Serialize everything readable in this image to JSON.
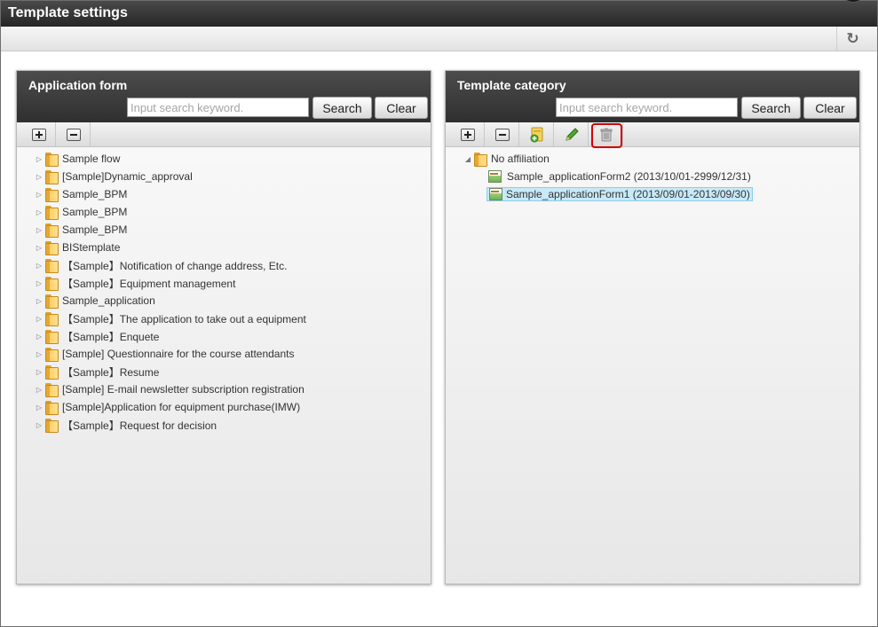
{
  "window": {
    "title": "Template settings"
  },
  "icons": {
    "refresh": "refresh-icon",
    "expand_all": "expand-all-icon",
    "collapse_all": "collapse-all-icon",
    "add_category": "add-category-icon",
    "edit": "pencil-icon",
    "delete": "trash-icon"
  },
  "left_panel": {
    "title": "Application form",
    "search_placeholder": "Input search keyword.",
    "search_label": "Search",
    "clear_label": "Clear",
    "items": [
      {
        "label": "Sample flow"
      },
      {
        "label": "[Sample]Dynamic_approval"
      },
      {
        "label": "Sample_BPM"
      },
      {
        "label": "Sample_BPM"
      },
      {
        "label": "Sample_BPM"
      },
      {
        "label": "BIStemplate"
      },
      {
        "label": "【Sample】Notification of change address, Etc."
      },
      {
        "label": "【Sample】Equipment management"
      },
      {
        "label": "Sample_application"
      },
      {
        "label": "【Sample】The application to take out a equipment"
      },
      {
        "label": "【Sample】Enquete"
      },
      {
        "label": "[Sample] Questionnaire for the course attendants"
      },
      {
        "label": "【Sample】Resume"
      },
      {
        "label": "[Sample] E-mail newsletter subscription registration"
      },
      {
        "label": "[Sample]Application for equipment purchase(IMW)"
      },
      {
        "label": "【Sample】Request for decision"
      }
    ]
  },
  "right_panel": {
    "title": "Template category",
    "search_placeholder": "Input search keyword.",
    "search_label": "Search",
    "clear_label": "Clear",
    "category": "No affiliation",
    "templates": [
      {
        "label": "Sample_applicationForm2 (2013/10/01-2999/12/31)",
        "selected": false
      },
      {
        "label": "Sample_applicationForm1 (2013/09/01-2013/09/30)",
        "selected": true
      }
    ],
    "highlight_color": "#d00000",
    "selected_color": "#c8e9f8"
  }
}
